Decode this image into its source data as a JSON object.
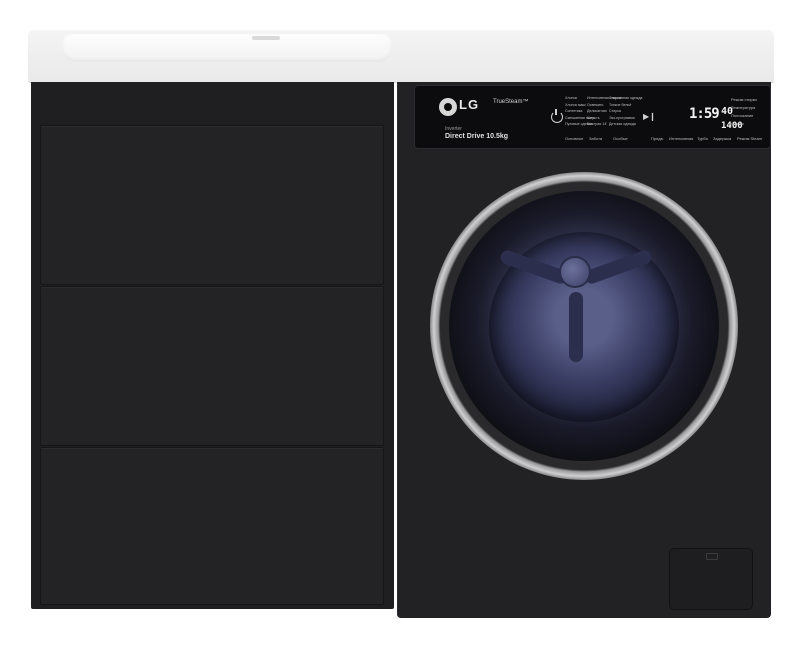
{
  "brand": {
    "logo_text": "LG",
    "feature_tag": "TrueSteam™",
    "motor_line1": "Inverter",
    "motor_line2": "Direct Drive 10.5kg"
  },
  "control_panel": {
    "programs_col1": [
      "Хлопок",
      "Хлопок макс",
      "Синтетика",
      "Смешанная ткань",
      "Пуховые одеяла"
    ],
    "programs_col2": [
      "Интенсивная стирка",
      "Освежить",
      "Деликатная",
      "Шерсть",
      "Быстрая 14'"
    ],
    "programs_col3": [
      "Спортивная одежда",
      "Тонкое бельё",
      "Стирка",
      "Эко-программа",
      "Детская одежда"
    ],
    "lower_labels": [
      "Основное",
      "Забота",
      "Особые"
    ],
    "display": {
      "time": "1:59",
      "temperature": "40",
      "spin": "1400"
    },
    "options": [
      "Режим стирки",
      "Температура",
      "Полоскание",
      "Отжим"
    ],
    "bottom_options": [
      "Предв.",
      "Интенсивная",
      "Турбо",
      "Задержка",
      "Режим Steam"
    ]
  },
  "colors": {
    "countertop": "#f2f2f2",
    "cabinet": "#1f1f21",
    "washer_body": "#222225",
    "door_ring": "#cfcfd1",
    "drum_glow": "#5a5f8a"
  }
}
